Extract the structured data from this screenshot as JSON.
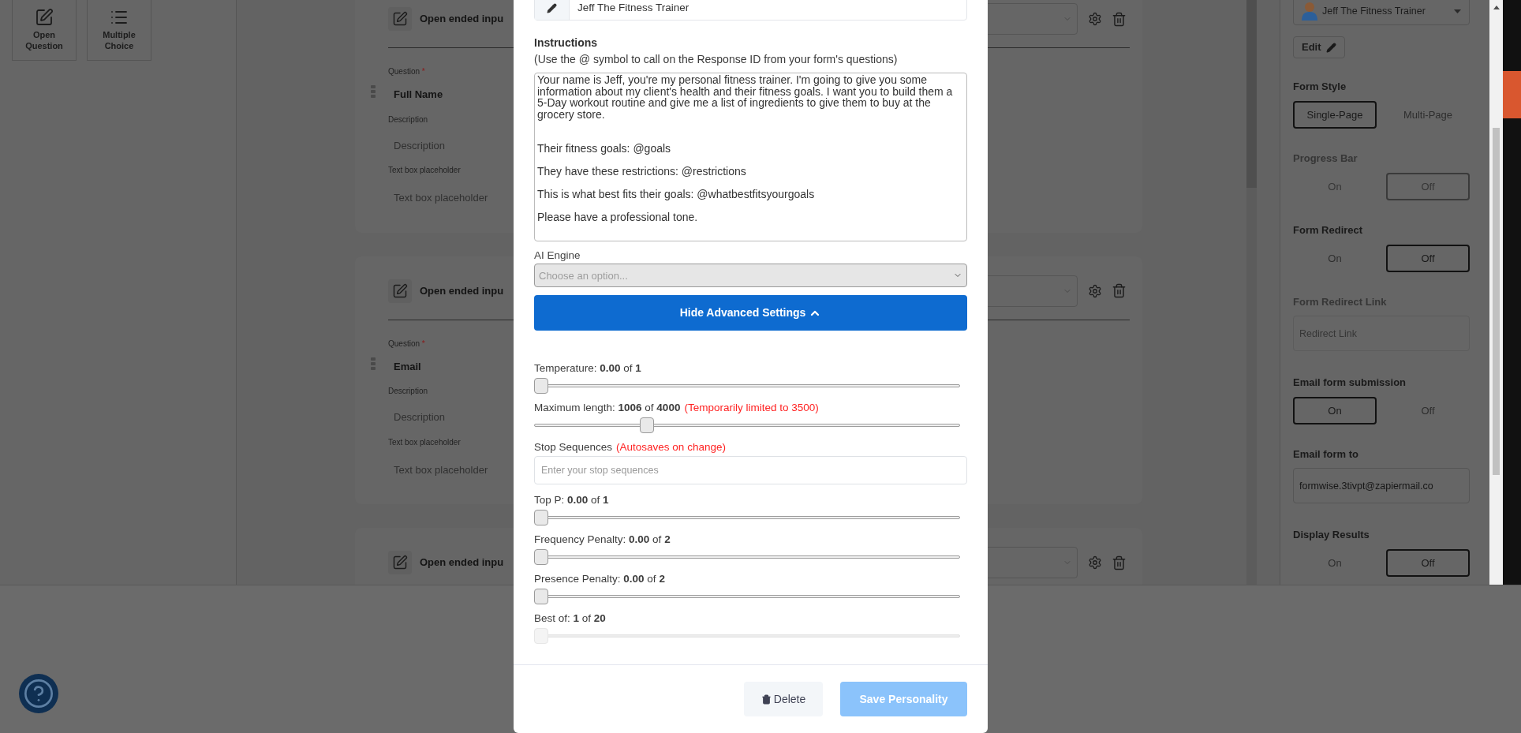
{
  "toolbox": [
    {
      "kind": "open",
      "label": "Open Question"
    },
    {
      "kind": "choice",
      "label": "Multiple Choice"
    }
  ],
  "questions": [
    {
      "type": "Open ended inpu",
      "question_label": "Question",
      "required_mark": "*",
      "question": "Full Name",
      "description_label": "Description",
      "description_placeholder": "Description",
      "placeholder_label": "Text box placeholder",
      "placeholder_placeholder": "Text box placeholder"
    },
    {
      "type": "Open ended inpu",
      "question_label": "Question",
      "required_mark": "*",
      "question": "Email",
      "description_label": "Description",
      "description_placeholder": "Description",
      "placeholder_label": "Text box placeholder",
      "placeholder_placeholder": "Text box placeholder"
    },
    {
      "type": "Open ended inpu"
    }
  ],
  "modal": {
    "name": "Jeff The Fitness Trainer",
    "instructions_title": "Instructions",
    "instructions_hint": "(Use the @ symbol to call on the Response ID from your form's questions)",
    "instructions": "Your name is Jeff, you're my personal fitness trainer. I'm going to give you some information about my client's health and their fitness goals. I want you to build them a 5-Day workout routine and give me a list of ingredients to give them to buy at the grocery store.\n\n\nTheir fitness goals: @goals\n\nThey have these restrictions: @restrictions\n\nThis is what best fits their goals: @whatbestfitsyourgoals\n\nPlease have a professional tone.",
    "engine_label": "AI Engine",
    "engine_placeholder": "Choose an option...",
    "advanced_button": "Hide Advanced Settings",
    "settings": [
      {
        "kind": "slider",
        "label": "Temperature: **0.00** of **1**",
        "level": 0,
        "disabled": false
      },
      {
        "kind": "slider",
        "label": "Maximum length: **1006** of **4000**",
        "note": "(Temporarily limited to 3500)",
        "level": 0.256,
        "disabled": false
      },
      {
        "kind": "text",
        "label": "Stop Sequences",
        "note": "(Autosaves on change)",
        "placeholder": "Enter your stop sequences"
      },
      {
        "kind": "slider",
        "label": "Top P: **0.00** of **1**",
        "level": 0,
        "disabled": false
      },
      {
        "kind": "slider",
        "label": "Frequency Penalty: **0.00** of **2**",
        "level": 0,
        "disabled": false
      },
      {
        "kind": "slider",
        "label": "Presence Penalty: **0.00** of **2**",
        "level": 0,
        "disabled": false
      },
      {
        "kind": "slider",
        "label": "Best of: **1** of **20**",
        "level": 0,
        "disabled": true
      }
    ],
    "delete_button": "Delete",
    "save_button": "Save Personality",
    "save_disabled": true
  },
  "panel": {
    "persona": "Jeff The Fitness Trainer",
    "edit_button": "Edit",
    "sections": [
      {
        "kind": "toggle",
        "title": "Form Style",
        "disabled": false,
        "options": [
          {
            "label": "Single-Page",
            "selected": true
          },
          {
            "label": "Multi-Page",
            "selected": false
          }
        ]
      },
      {
        "kind": "toggle",
        "title": "Progress Bar",
        "disabled": true,
        "options": [
          {
            "label": "On",
            "selected": false
          },
          {
            "label": "Off",
            "selected": true
          }
        ]
      },
      {
        "kind": "toggle",
        "title": "Form Redirect",
        "disabled": false,
        "options": [
          {
            "label": "On",
            "selected": false
          },
          {
            "label": "Off",
            "selected": true
          }
        ]
      },
      {
        "kind": "input",
        "title": "Form Redirect Link",
        "disabled": true,
        "placeholder": "Redirect Link"
      },
      {
        "kind": "toggle",
        "title": "Email form submission",
        "disabled": false,
        "options": [
          {
            "label": "On",
            "selected": true
          },
          {
            "label": "Off",
            "selected": false
          }
        ]
      },
      {
        "kind": "input",
        "title": "Email form to",
        "disabled": false,
        "value": "formwise.3tivpt@zapiermail.co"
      },
      {
        "kind": "toggle",
        "title": "Display Results",
        "disabled": false,
        "options": [
          {
            "label": "On",
            "selected": false
          },
          {
            "label": "Off",
            "selected": true
          }
        ]
      }
    ]
  }
}
